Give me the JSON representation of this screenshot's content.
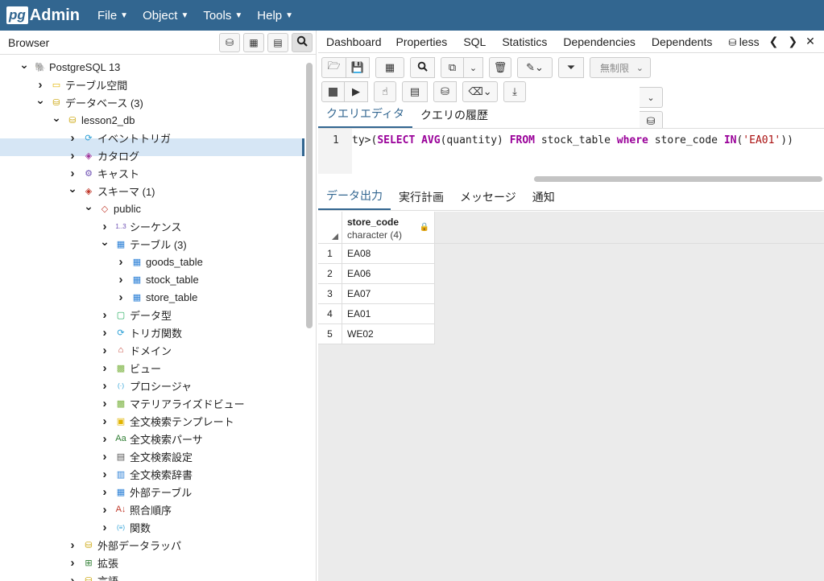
{
  "app": {
    "logo_pg": "pg",
    "logo_admin": "Admin"
  },
  "menu": [
    {
      "label": "File"
    },
    {
      "label": "Object"
    },
    {
      "label": "Tools"
    },
    {
      "label": "Help"
    }
  ],
  "browser": {
    "title": "Browser",
    "tree": [
      {
        "label": "PostgreSQL 13",
        "expanded": true,
        "icon": "elephant-icon"
      },
      {
        "label": "テーブル空間",
        "expanded": false,
        "icon": "folder-icon"
      },
      {
        "label": "データベース (3)",
        "expanded": true,
        "icon": "database-icon"
      },
      {
        "label": "lesson2_db",
        "expanded": true,
        "icon": "database-icon",
        "selected": true
      },
      {
        "label": "イベントトリガ",
        "expanded": false,
        "icon": "event-trigger-icon"
      },
      {
        "label": "カタログ",
        "expanded": false,
        "icon": "catalog-icon"
      },
      {
        "label": "キャスト",
        "expanded": false,
        "icon": "cast-icon"
      },
      {
        "label": "スキーマ (1)",
        "expanded": true,
        "icon": "schema-icon"
      },
      {
        "label": "public",
        "expanded": true,
        "icon": "public-schema-icon"
      },
      {
        "label": "シーケンス",
        "expanded": false,
        "icon": "sequence-icon"
      },
      {
        "label": "テーブル (3)",
        "expanded": true,
        "icon": "tables-icon"
      },
      {
        "label": "goods_table",
        "expanded": false,
        "icon": "table-icon"
      },
      {
        "label": "stock_table",
        "expanded": false,
        "icon": "table-icon"
      },
      {
        "label": "store_table",
        "expanded": false,
        "icon": "table-icon"
      },
      {
        "label": "データ型",
        "expanded": false,
        "icon": "datatype-icon"
      },
      {
        "label": "トリガ関数",
        "expanded": false,
        "icon": "trigger-function-icon"
      },
      {
        "label": "ドメイン",
        "expanded": false,
        "icon": "domain-icon"
      },
      {
        "label": "ビュー",
        "expanded": false,
        "icon": "view-icon"
      },
      {
        "label": "プロシージャ",
        "expanded": false,
        "icon": "procedure-icon"
      },
      {
        "label": "マテリアライズドビュー",
        "expanded": false,
        "icon": "matview-icon"
      },
      {
        "label": "全文検索テンプレート",
        "expanded": false,
        "icon": "fts-template-icon"
      },
      {
        "label": "全文検索パーサ",
        "expanded": false,
        "icon": "fts-parser-icon"
      },
      {
        "label": "全文検索設定",
        "expanded": false,
        "icon": "fts-config-icon"
      },
      {
        "label": "全文検索辞書",
        "expanded": false,
        "icon": "fts-dictionary-icon"
      },
      {
        "label": "外部テーブル",
        "expanded": false,
        "icon": "foreign-table-icon"
      },
      {
        "label": "照合順序",
        "expanded": false,
        "icon": "collation-icon"
      },
      {
        "label": "関数",
        "expanded": false,
        "icon": "function-icon"
      },
      {
        "label": "外部データラッパ",
        "expanded": false,
        "icon": "fdw-icon"
      },
      {
        "label": "拡張",
        "expanded": false,
        "icon": "extension-icon"
      },
      {
        "label": "言語",
        "expanded": false,
        "icon": "language-icon"
      }
    ]
  },
  "tabs": [
    "Dashboard",
    "Properties",
    "SQL",
    "Statistics",
    "Dependencies",
    "Dependents",
    "less"
  ],
  "toolbar": {
    "limit_label": "無制限"
  },
  "query_tabs": [
    {
      "label": "クエリエディタ",
      "active": true
    },
    {
      "label": "クエリの履歴",
      "active": false
    }
  ],
  "editor": {
    "line_number": "1",
    "code_parts": [
      {
        "t": "ty>(",
        "c": "plain"
      },
      {
        "t": "SELECT",
        "c": "kw"
      },
      {
        "t": " ",
        "c": "plain"
      },
      {
        "t": "AVG",
        "c": "kw"
      },
      {
        "t": "(quantity) ",
        "c": "plain"
      },
      {
        "t": "FROM",
        "c": "kw"
      },
      {
        "t": " stock_table ",
        "c": "plain"
      },
      {
        "t": "where",
        "c": "kw"
      },
      {
        "t": " store_code ",
        "c": "plain"
      },
      {
        "t": "IN",
        "c": "kw"
      },
      {
        "t": "(",
        "c": "plain"
      },
      {
        "t": "'EA01'",
        "c": "str"
      },
      {
        "t": "))",
        "c": "plain"
      }
    ]
  },
  "output_tabs": [
    {
      "label": "データ出力",
      "active": true
    },
    {
      "label": "実行計画",
      "active": false
    },
    {
      "label": "メッセージ",
      "active": false
    },
    {
      "label": "通知",
      "active": false
    }
  ],
  "result": {
    "column": {
      "name": "store_code",
      "type": "character (4)"
    },
    "rows": [
      {
        "n": "1",
        "v": "EA08"
      },
      {
        "n": "2",
        "v": "EA06"
      },
      {
        "n": "3",
        "v": "EA07"
      },
      {
        "n": "4",
        "v": "EA01"
      },
      {
        "n": "5",
        "v": "WE02"
      }
    ]
  }
}
